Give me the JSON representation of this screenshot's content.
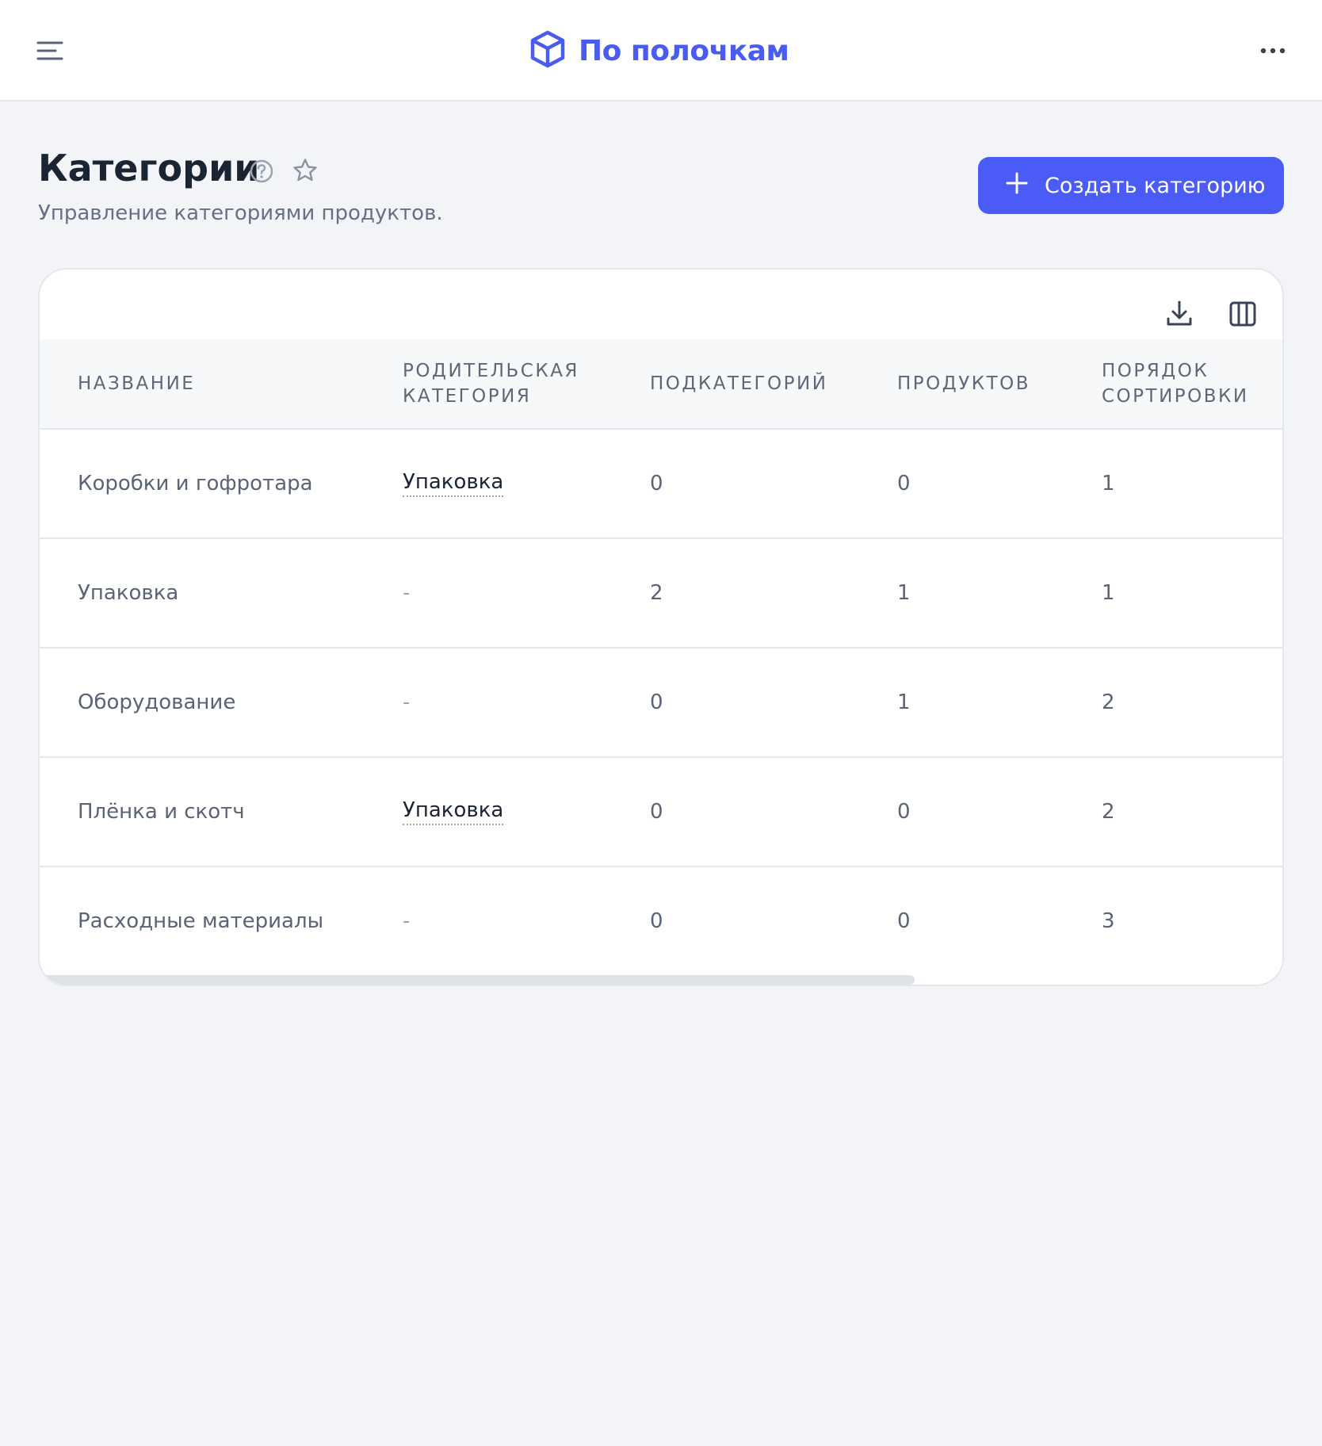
{
  "header": {
    "brand_name": "По полочкам",
    "brand_color": "#4a5cf0",
    "menu_icon": "hamburger-menu-icon",
    "brand_icon": "cube-icon",
    "more_icon": "more-horizontal-icon"
  },
  "page": {
    "title": "Категории",
    "subtitle": "Управление категориями продуктов.",
    "create_button_label": "Создать категорию",
    "accent_color": "#4a5cf5"
  },
  "table": {
    "columns": [
      "НАЗВАНИЕ",
      "РОДИТЕЛЬСКАЯ КАТЕГОРИЯ",
      "ПОДКАТЕГОРИЙ",
      "ПРОДУКТОВ",
      "ПОРЯДОК СОРТИРОВКИ"
    ],
    "rows": [
      {
        "name": "Коробки и гофротара",
        "parent": "Упаковка",
        "subcategories": "0",
        "products": "0",
        "sort_order": "1"
      },
      {
        "name": "Упаковка",
        "parent": "-",
        "subcategories": "2",
        "products": "1",
        "sort_order": "1"
      },
      {
        "name": "Оборудование",
        "parent": "-",
        "subcategories": "0",
        "products": "1",
        "sort_order": "2"
      },
      {
        "name": "Плёнка и скотч",
        "parent": "Упаковка",
        "subcategories": "0",
        "products": "0",
        "sort_order": "2"
      },
      {
        "name": "Расходные материалы",
        "parent": "-",
        "subcategories": "0",
        "products": "0",
        "sort_order": "3"
      }
    ]
  }
}
